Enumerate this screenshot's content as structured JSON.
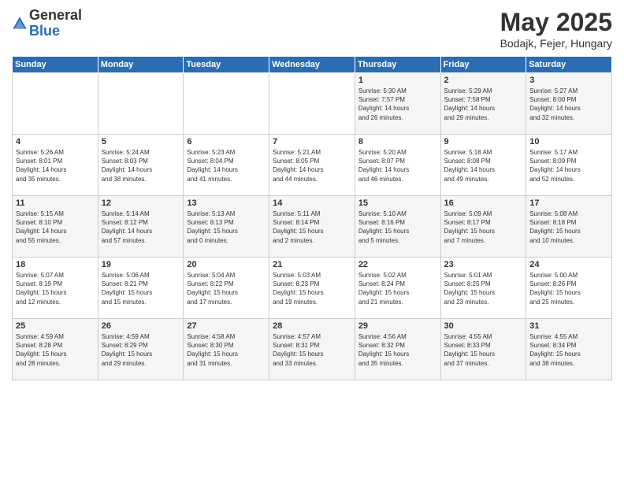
{
  "logo": {
    "general": "General",
    "blue": "Blue"
  },
  "title": "May 2025",
  "location": "Bodajk, Fejer, Hungary",
  "days_header": [
    "Sunday",
    "Monday",
    "Tuesday",
    "Wednesday",
    "Thursday",
    "Friday",
    "Saturday"
  ],
  "weeks": [
    [
      {
        "day": "",
        "info": ""
      },
      {
        "day": "",
        "info": ""
      },
      {
        "day": "",
        "info": ""
      },
      {
        "day": "",
        "info": ""
      },
      {
        "day": "1",
        "info": "Sunrise: 5:30 AM\nSunset: 7:57 PM\nDaylight: 14 hours\nand 26 minutes."
      },
      {
        "day": "2",
        "info": "Sunrise: 5:29 AM\nSunset: 7:58 PM\nDaylight: 14 hours\nand 29 minutes."
      },
      {
        "day": "3",
        "info": "Sunrise: 5:27 AM\nSunset: 8:00 PM\nDaylight: 14 hours\nand 32 minutes."
      }
    ],
    [
      {
        "day": "4",
        "info": "Sunrise: 5:26 AM\nSunset: 8:01 PM\nDaylight: 14 hours\nand 35 minutes."
      },
      {
        "day": "5",
        "info": "Sunrise: 5:24 AM\nSunset: 8:03 PM\nDaylight: 14 hours\nand 38 minutes."
      },
      {
        "day": "6",
        "info": "Sunrise: 5:23 AM\nSunset: 8:04 PM\nDaylight: 14 hours\nand 41 minutes."
      },
      {
        "day": "7",
        "info": "Sunrise: 5:21 AM\nSunset: 8:05 PM\nDaylight: 14 hours\nand 44 minutes."
      },
      {
        "day": "8",
        "info": "Sunrise: 5:20 AM\nSunset: 8:07 PM\nDaylight: 14 hours\nand 46 minutes."
      },
      {
        "day": "9",
        "info": "Sunrise: 5:18 AM\nSunset: 8:08 PM\nDaylight: 14 hours\nand 49 minutes."
      },
      {
        "day": "10",
        "info": "Sunrise: 5:17 AM\nSunset: 8:09 PM\nDaylight: 14 hours\nand 52 minutes."
      }
    ],
    [
      {
        "day": "11",
        "info": "Sunrise: 5:15 AM\nSunset: 8:10 PM\nDaylight: 14 hours\nand 55 minutes."
      },
      {
        "day": "12",
        "info": "Sunrise: 5:14 AM\nSunset: 8:12 PM\nDaylight: 14 hours\nand 57 minutes."
      },
      {
        "day": "13",
        "info": "Sunrise: 5:13 AM\nSunset: 8:13 PM\nDaylight: 15 hours\nand 0 minutes."
      },
      {
        "day": "14",
        "info": "Sunrise: 5:11 AM\nSunset: 8:14 PM\nDaylight: 15 hours\nand 2 minutes."
      },
      {
        "day": "15",
        "info": "Sunrise: 5:10 AM\nSunset: 8:16 PM\nDaylight: 15 hours\nand 5 minutes."
      },
      {
        "day": "16",
        "info": "Sunrise: 5:09 AM\nSunset: 8:17 PM\nDaylight: 15 hours\nand 7 minutes."
      },
      {
        "day": "17",
        "info": "Sunrise: 5:08 AM\nSunset: 8:18 PM\nDaylight: 15 hours\nand 10 minutes."
      }
    ],
    [
      {
        "day": "18",
        "info": "Sunrise: 5:07 AM\nSunset: 8:19 PM\nDaylight: 15 hours\nand 12 minutes."
      },
      {
        "day": "19",
        "info": "Sunrise: 5:06 AM\nSunset: 8:21 PM\nDaylight: 15 hours\nand 15 minutes."
      },
      {
        "day": "20",
        "info": "Sunrise: 5:04 AM\nSunset: 8:22 PM\nDaylight: 15 hours\nand 17 minutes."
      },
      {
        "day": "21",
        "info": "Sunrise: 5:03 AM\nSunset: 8:23 PM\nDaylight: 15 hours\nand 19 minutes."
      },
      {
        "day": "22",
        "info": "Sunrise: 5:02 AM\nSunset: 8:24 PM\nDaylight: 15 hours\nand 21 minutes."
      },
      {
        "day": "23",
        "info": "Sunrise: 5:01 AM\nSunset: 8:25 PM\nDaylight: 15 hours\nand 23 minutes."
      },
      {
        "day": "24",
        "info": "Sunrise: 5:00 AM\nSunset: 8:26 PM\nDaylight: 15 hours\nand 25 minutes."
      }
    ],
    [
      {
        "day": "25",
        "info": "Sunrise: 4:59 AM\nSunset: 8:28 PM\nDaylight: 15 hours\nand 28 minutes."
      },
      {
        "day": "26",
        "info": "Sunrise: 4:59 AM\nSunset: 8:29 PM\nDaylight: 15 hours\nand 29 minutes."
      },
      {
        "day": "27",
        "info": "Sunrise: 4:58 AM\nSunset: 8:30 PM\nDaylight: 15 hours\nand 31 minutes."
      },
      {
        "day": "28",
        "info": "Sunrise: 4:57 AM\nSunset: 8:31 PM\nDaylight: 15 hours\nand 33 minutes."
      },
      {
        "day": "29",
        "info": "Sunrise: 4:56 AM\nSunset: 8:32 PM\nDaylight: 15 hours\nand 35 minutes."
      },
      {
        "day": "30",
        "info": "Sunrise: 4:55 AM\nSunset: 8:33 PM\nDaylight: 15 hours\nand 37 minutes."
      },
      {
        "day": "31",
        "info": "Sunrise: 4:55 AM\nSunset: 8:34 PM\nDaylight: 15 hours\nand 38 minutes."
      }
    ]
  ]
}
